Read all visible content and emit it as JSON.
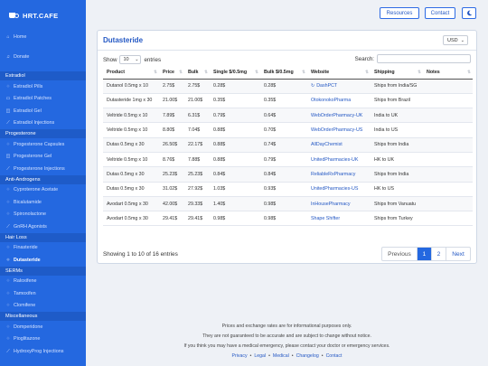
{
  "brand": "HRT.CAFE",
  "topbar": {
    "resources": "Resources",
    "contact": "Contact",
    "theme_icon": "moon-icon"
  },
  "sidebar": {
    "items": [
      {
        "type": "item",
        "label": "Home",
        "icon": "home-icon",
        "glyph": "⌂"
      },
      {
        "type": "gap"
      },
      {
        "type": "item",
        "label": "Donate",
        "icon": "donate-icon",
        "glyph": "♫"
      },
      {
        "type": "gap"
      },
      {
        "type": "header",
        "label": "Estradiol"
      },
      {
        "type": "item",
        "label": "Estradiol Pills",
        "icon": "pill-icon",
        "glyph": "⁘"
      },
      {
        "type": "item",
        "label": "Estradiol Patches",
        "icon": "patch-icon",
        "glyph": "▭"
      },
      {
        "type": "item",
        "label": "Estradiol Gel",
        "icon": "gel-icon",
        "glyph": "◫"
      },
      {
        "type": "item",
        "label": "Estradiol Injections",
        "icon": "syringe-icon",
        "glyph": "⟋"
      },
      {
        "type": "header",
        "label": "Progesterone"
      },
      {
        "type": "item",
        "label": "Progesterone Capsules",
        "icon": "capsule-icon",
        "glyph": "⁘"
      },
      {
        "type": "item",
        "label": "Progesterone Gel",
        "icon": "gel-icon",
        "glyph": "◫"
      },
      {
        "type": "item",
        "label": "Progesterone Injections",
        "icon": "syringe-icon",
        "glyph": "⟋"
      },
      {
        "type": "header",
        "label": "Anti-Androgens"
      },
      {
        "type": "item",
        "label": "Cyproterone Acetate",
        "icon": "pill-icon",
        "glyph": "⁘"
      },
      {
        "type": "item",
        "label": "Bicalutamide",
        "icon": "pill-icon",
        "glyph": "⁘"
      },
      {
        "type": "item",
        "label": "Spironolactone",
        "icon": "pill-icon",
        "glyph": "⁘"
      },
      {
        "type": "item",
        "label": "GnRH Agonists",
        "icon": "syringe-icon",
        "glyph": "⟋"
      },
      {
        "type": "header",
        "label": "Hair Loss"
      },
      {
        "type": "item",
        "label": "Finasteride",
        "icon": "pill-icon",
        "glyph": "⁘"
      },
      {
        "type": "item",
        "label": "Dutasteride",
        "icon": "pill-icon",
        "glyph": "⁘",
        "active": true
      },
      {
        "type": "header",
        "label": "SERMs"
      },
      {
        "type": "item",
        "label": "Raloxifene",
        "icon": "pill-icon",
        "glyph": "⁘"
      },
      {
        "type": "item",
        "label": "Tamoxifen",
        "icon": "pill-icon",
        "glyph": "⁘"
      },
      {
        "type": "item",
        "label": "Clomifene",
        "icon": "pill-icon",
        "glyph": "⁘"
      },
      {
        "type": "header",
        "label": "Miscellaneous"
      },
      {
        "type": "item",
        "label": "Domperidone",
        "icon": "pill-icon",
        "glyph": "⁘"
      },
      {
        "type": "item",
        "label": "Pioglitazone",
        "icon": "pill-icon",
        "glyph": "⁘"
      },
      {
        "type": "item",
        "label": "HydroxyProg Injections",
        "icon": "syringe-icon",
        "glyph": "⟋"
      }
    ]
  },
  "card": {
    "title": "Dutasteride",
    "currency": "USD",
    "show_label": "Show",
    "entries_value": "10",
    "entries_label": "entries",
    "search_label": "Search:",
    "search_value": "",
    "columns": [
      "Product",
      "Price",
      "Bulk",
      "Single $/0.5mg",
      "Bulk $/0.5mg",
      "Website",
      "Shipping",
      "Notes"
    ],
    "rows": [
      [
        "Dutanol 0.5mg x 10",
        "2.75$",
        "2.75$",
        "0.28$",
        "0.28$",
        "DashPCT",
        "Ships from India/SG",
        ""
      ],
      [
        "Dutasteride 1mg x 30",
        "21.00$",
        "21.00$",
        "0.35$",
        "0.35$",
        "OtokonokoPharma",
        "Ships from Brazil",
        ""
      ],
      [
        "Veltride 0.5mg x 10",
        "7.89$",
        "6.31$",
        "0.79$",
        "0.64$",
        "WebOrderPharmacy-UK",
        "India to UK",
        ""
      ],
      [
        "Veltride 0.5mg x 10",
        "8.80$",
        "7.04$",
        "0.88$",
        "0.70$",
        "WebOrderPharmacy-US",
        "India to US",
        ""
      ],
      [
        "Dutas 0.5mg x 30",
        "26.50$",
        "22.17$",
        "0.88$",
        "0.74$",
        "AllDayChemist",
        "Ships from India",
        ""
      ],
      [
        "Veltride 0.5mg x 10",
        "8.76$",
        "7.88$",
        "0.88$",
        "0.79$",
        "UnitedPharmacies-UK",
        "HK to UK",
        ""
      ],
      [
        "Dutas 0.5mg x 30",
        "25.23$",
        "25.23$",
        "0.84$",
        "0.84$",
        "ReliableRxPharmacy",
        "Ships from India",
        ""
      ],
      [
        "Dutas 0.5mg x 30",
        "31.02$",
        "27.92$",
        "1.03$",
        "0.93$",
        "UnitedPharmacies-US",
        "HK to US",
        ""
      ],
      [
        "Avodart 0.5mg x 30",
        "42.00$",
        "29.33$",
        "1.40$",
        "0.98$",
        "InHousePharmacy",
        "Ships from Vanuatu",
        ""
      ],
      [
        "Avodart 0.5mg x 30",
        "29.41$",
        "29.41$",
        "0.98$",
        "0.98$",
        "Shape Shifter",
        "Ships from Turkey",
        ""
      ]
    ],
    "info": "Showing 1 to 10 of 16 entries",
    "pager": {
      "previous": "Previous",
      "page1": "1",
      "page2": "2",
      "next": "Next"
    }
  },
  "footer": {
    "line1": "Prices and exchange rates are for informational purposes only.",
    "line2": "They are not guaranteed to be accurate and are subject to change without notice.",
    "line3": "If you think you may have a medical emergency, please contact your doctor or emergency services.",
    "links": [
      "Privacy",
      "Legal",
      "Medical",
      "Changelog",
      "Contact"
    ],
    "sep": "•"
  },
  "colors": {
    "sidebar": "#2468e0",
    "accent": "#2458c4",
    "background": "#eef1f6"
  }
}
